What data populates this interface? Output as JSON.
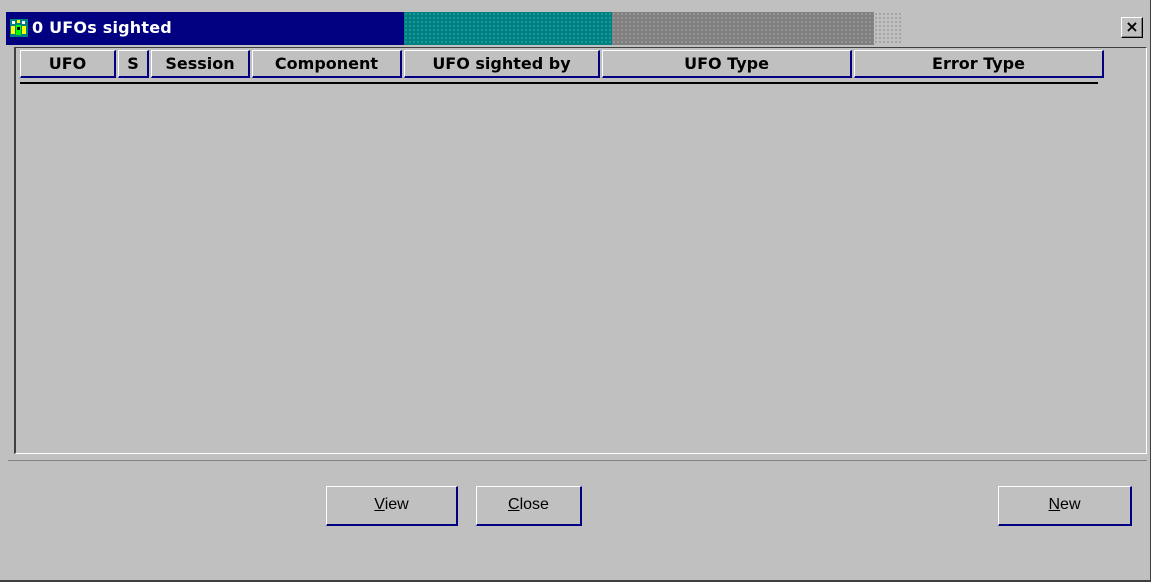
{
  "window": {
    "title": "0 UFOs sighted",
    "app_icon": "ufo-app-icon",
    "close_label": "×"
  },
  "columns": [
    {
      "label": "UFO"
    },
    {
      "label": "S"
    },
    {
      "label": "Session"
    },
    {
      "label": "Component"
    },
    {
      "label": "UFO sighted by"
    },
    {
      "label": "UFO Type"
    },
    {
      "label": "Error Type"
    }
  ],
  "rows": [],
  "buttons": {
    "view": {
      "mnemonic": "V",
      "rest": "iew"
    },
    "close": {
      "mnemonic": "C",
      "rest": "lose"
    },
    "new": {
      "mnemonic": "N",
      "rest": "ew"
    }
  },
  "colors": {
    "titlebar": "#000080",
    "window_bg": "#c0c0c0",
    "band_teal": "#008080",
    "band_gray": "#808080"
  }
}
